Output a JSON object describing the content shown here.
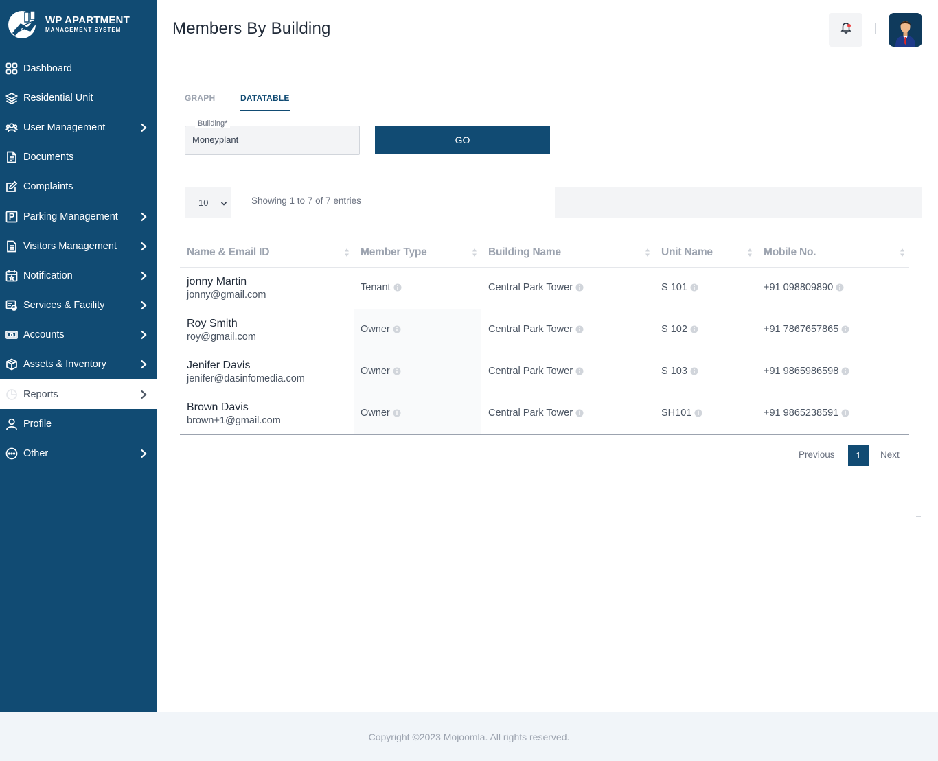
{
  "brand": {
    "title": "WP APARTMENT",
    "subtitle": "MANAGEMENT SYSTEM",
    "color": "#114b73"
  },
  "sidebar": {
    "items": [
      {
        "label": "Dashboard",
        "icon": "grid-icon",
        "has_submenu": false
      },
      {
        "label": "Residential Unit",
        "icon": "layers-icon",
        "has_submenu": false
      },
      {
        "label": "User Management",
        "icon": "users-icon",
        "has_submenu": true
      },
      {
        "label": "Documents",
        "icon": "document-icon",
        "has_submenu": false
      },
      {
        "label": "Complaints",
        "icon": "edit-icon",
        "has_submenu": false
      },
      {
        "label": "Parking Management",
        "icon": "parking-icon",
        "has_submenu": true
      },
      {
        "label": "Visitors Management",
        "icon": "clipboard-icon",
        "has_submenu": true
      },
      {
        "label": "Notification",
        "icon": "calendar-icon",
        "has_submenu": true
      },
      {
        "label": "Services & Facility",
        "icon": "service-icon",
        "has_submenu": true
      },
      {
        "label": "Accounts",
        "icon": "cash-icon",
        "has_submenu": true
      },
      {
        "label": "Assets & Inventory",
        "icon": "box-icon",
        "has_submenu": true
      },
      {
        "label": "Reports",
        "icon": "report-icon",
        "has_submenu": true,
        "active": true
      },
      {
        "label": "Profile",
        "icon": "user-icon",
        "has_submenu": false
      },
      {
        "label": "Other",
        "icon": "more-icon",
        "has_submenu": true
      }
    ]
  },
  "header": {
    "title": "Members By Building"
  },
  "tabs": [
    {
      "label": "GRAPH",
      "active": false
    },
    {
      "label": "DATATABLE",
      "active": true
    }
  ],
  "filter": {
    "building_label": "Building*",
    "building_value": "Moneyplant",
    "go_label": "GO"
  },
  "table_controls": {
    "page_length": "10",
    "showing_text": "Showing 1 to 7 of 7 entries"
  },
  "table": {
    "columns": [
      "Name & Email ID",
      "Member Type",
      "Building Name",
      "Unit Name",
      "Mobile No."
    ],
    "rows": [
      {
        "name": "jonny Martin",
        "email": "jonny@gmail.com",
        "member_type": "Tenant",
        "building": "Central Park Tower",
        "unit": "S 101",
        "mobile": "+91 098809890"
      },
      {
        "name": "Roy Smith",
        "email": "roy@gmail.com",
        "member_type": "Owner",
        "building": "Central Park Tower",
        "unit": "S 102",
        "mobile": "+91 7867657865"
      },
      {
        "name": "Jenifer Davis",
        "email": "jenifer@dasinfomedia.com",
        "member_type": "Owner",
        "building": "Central Park Tower",
        "unit": "S 103",
        "mobile": "+91 9865986598"
      },
      {
        "name": "Brown Davis",
        "email": "brown+1@gmail.com",
        "member_type": "Owner",
        "building": "Central Park Tower",
        "unit": "SH101",
        "mobile": "+91 9865238591"
      }
    ]
  },
  "pagination": {
    "previous": "Previous",
    "current": "1",
    "next": "Next"
  },
  "footer": {
    "copyright": "Copyright ©2023 Mojoomla. All rights reserved."
  }
}
